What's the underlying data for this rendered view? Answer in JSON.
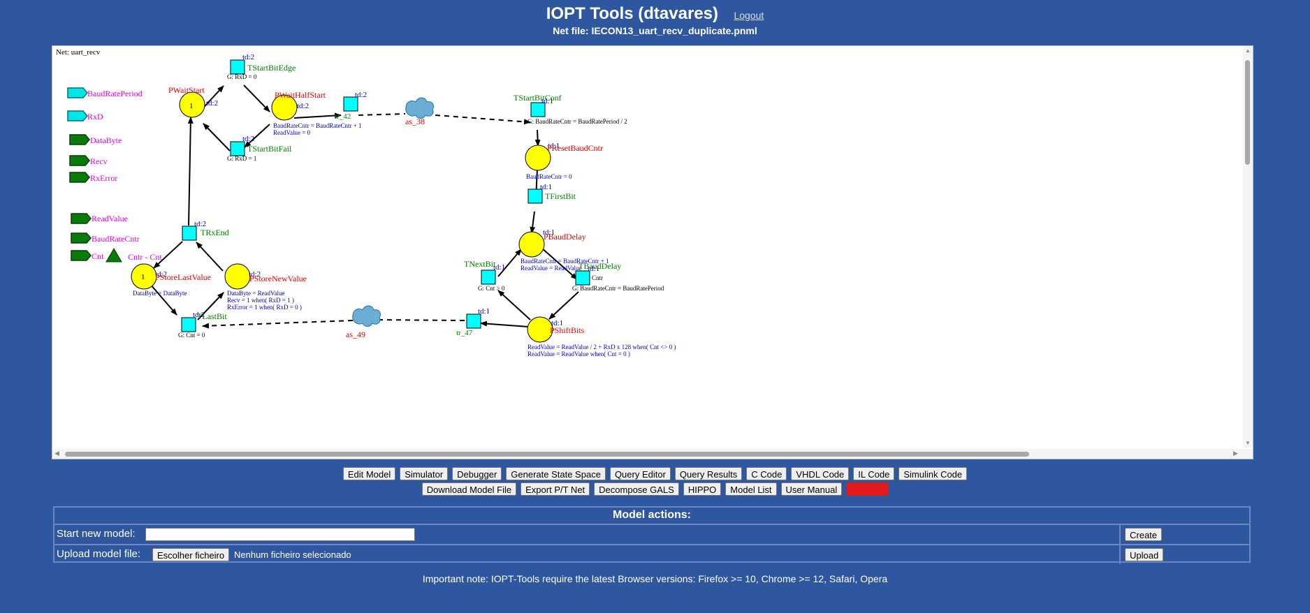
{
  "header": {
    "title": "IOPT Tools (dtavares)",
    "logout": "Logout",
    "netfile_label": "Net file:",
    "netfile_name": "IECON13_uart_recv_duplicate.pnml"
  },
  "net": {
    "name": "Net: uart_recv",
    "signals": {
      "in1": "BaudRatePeriod",
      "in2": "RxD",
      "out1": "DataByte",
      "out2": "Recv",
      "out3": "RxError",
      "out4": "ReadValue",
      "out5": "BaudRateCntr",
      "out6": "Cnt",
      "tri": "Cntr - Cnt"
    },
    "places": {
      "pwaitstart": "PWaitStart",
      "pwaithalfstart": "PWaitHalfStart",
      "presetbaudcntr": "PResetBaudCntr",
      "pbauddelay": "PBaudDelay",
      "pshiftbits": "PShiftBits",
      "pstorelastvalue": "PStoreLastValue",
      "pstorenewvalue": "PStoreNewValue"
    },
    "transitions": {
      "tstartbitedge": "TStartBitEdge",
      "tstartbitfail": "TStartBitFail",
      "tr42": "tr_42",
      "tstartbitconf": "TStartBitConf",
      "tfirstbit": "TFirstBit",
      "tbauddelay": "TBaudDelay",
      "tnextbit": "TNextBit",
      "tr47": "tr_47",
      "tlastbit": "TLastBit",
      "trxend": "TRxEnd"
    },
    "clouds": {
      "as38": "as_38",
      "as49": "as_49"
    },
    "marks": {
      "one": "1",
      "td1": "td:1",
      "td2": "td:2"
    },
    "annotations": {
      "g_rxd0": "G: RxD = 0",
      "g_rxd1": "G: RxD = 1",
      "pwhs_a1": "BaudRateCntr = BaudRateCntr + 1",
      "pwhs_a2": "ReadValue = 0",
      "g_conf": "G: BaudRateCntr = BaudRatePeriod / 2",
      "preset_a": "BaudRateCntr = 0",
      "pbd_a1": "BaudRateCntr = BaudRateCntr + 1",
      "pbd_a2": "ReadValue = ReadValue",
      "cntr": "Cntr",
      "g_tbd": "G: BaudRateCntr = BaudRatePeriod",
      "g_next": "G: Cnt > 0",
      "psb_a1": "ReadValue = ReadValue / 2 + RxD x 128 when( Cnt <> 0 )",
      "psb_a2": "ReadValue = ReadValue when( Cnt = 0 )",
      "psl_a": "DataByte = DataByte",
      "psn_a1": "DataByte = ReadValue",
      "psn_a2": "Recv = 1 when( RxD = 1 )",
      "psn_a3": "RxError = 1 when( RxD = 0 )",
      "g_last": "G: Cnt = 0"
    }
  },
  "toolbar": {
    "row1": [
      "Edit Model",
      "Simulator",
      "Debugger",
      "Generate State Space",
      "Query Editor",
      "Query Results",
      "C Code",
      "VHDL Code",
      "IL Code",
      "Simulink Code"
    ],
    "row2": [
      "Download Model File",
      "Export P/T Net",
      "Decompose GALS",
      "HIPPO",
      "Model List",
      "User Manual",
      ""
    ]
  },
  "actions": {
    "title": "Model actions:",
    "start_label": "Start new model:",
    "start_value": "",
    "create": "Create",
    "upload_label": "Upload model file:",
    "choose_file": "Escolher ficheiro",
    "no_file": "Nenhum ficheiro selecionado",
    "upload": "Upload"
  },
  "note": "Important note: IOPT-Tools require the latest Browser versions: Firefox >= 10, Chrome >= 12, Safari, Opera",
  "colors": {
    "background": "#2f57a0",
    "place": "#ffff00",
    "transition": "#00ffff",
    "place_label": "#ff0000",
    "transition_label": "#008000",
    "signal_label": "#ff00ff",
    "annotation": "#0000cc",
    "delete_button": "#e11b1b"
  }
}
